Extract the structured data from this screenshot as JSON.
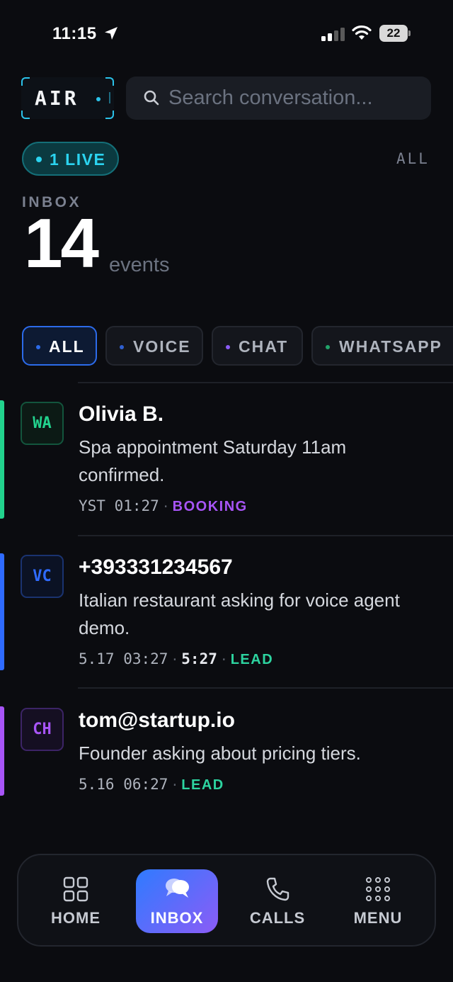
{
  "status_bar": {
    "time": "11:15",
    "battery": "22"
  },
  "header": {
    "logo_text": "AIR",
    "search_placeholder": "Search conversation..."
  },
  "live_badge": "1 LIVE",
  "all_link": "ALL",
  "inbox": {
    "label": "INBOX",
    "count": "14",
    "unit": "events"
  },
  "filters": [
    {
      "label": "ALL",
      "dot": "#2c6bea"
    },
    {
      "label": "VOICE",
      "dot": "#2f5fd0"
    },
    {
      "label": "CHAT",
      "dot": "#8b5cf6"
    },
    {
      "label": "WHATSAPP",
      "dot": "#22a36a"
    }
  ],
  "conversations": [
    {
      "channel": "WA",
      "name": "Olivia B.",
      "message": "Spa appointment Saturday 11am confirmed.",
      "time": "YST 01:27",
      "duration": "",
      "tag": "BOOKING",
      "accent": "#22d38e",
      "tag_color": "#a855f7"
    },
    {
      "channel": "VC",
      "name": "+393331234567",
      "message": "Italian restaurant asking for voice agent demo.",
      "time": "5.17 03:27",
      "duration": "5:27",
      "tag": "LEAD",
      "accent": "#2f6bff",
      "tag_color": "#2dd4a0"
    },
    {
      "channel": "CH",
      "name": "tom@startup.io",
      "message": "Founder asking about pricing tiers.",
      "time": "5.16 06:27",
      "duration": "",
      "tag": "LEAD",
      "accent": "#a855f7",
      "tag_color": "#2dd4a0"
    }
  ],
  "nav": {
    "home": "HOME",
    "inbox": "INBOX",
    "calls": "CALLS",
    "menu": "MENU"
  },
  "colors": {
    "background": "#0b0c10",
    "accent_cyan": "#2bd4f0",
    "accent_blue": "#2c6bea"
  }
}
